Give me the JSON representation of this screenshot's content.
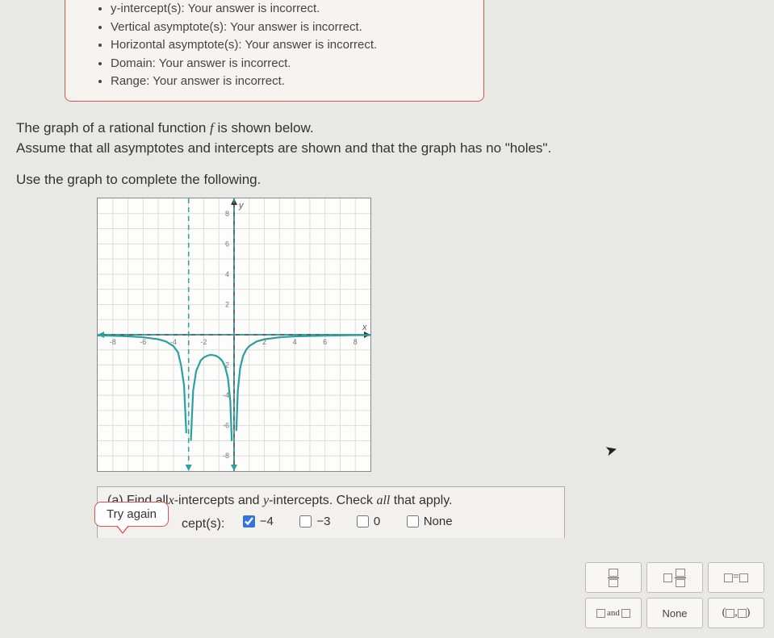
{
  "feedback": {
    "items": [
      {
        "label": "y-intercept(s):",
        "msg": "Your answer is incorrect."
      },
      {
        "label": "Vertical asymptote(s):",
        "msg": "Your answer is incorrect."
      },
      {
        "label": "Horizontal asymptote(s):",
        "msg": "Your answer is incorrect."
      },
      {
        "label": "Domain:",
        "msg": "Your answer is incorrect."
      },
      {
        "label": "Range:",
        "msg": "Your answer is incorrect."
      }
    ]
  },
  "problem": {
    "line1_pre": "The graph of a rational function ",
    "line1_f": "f",
    "line1_post": " is shown below.",
    "line2": "Assume that all asymptotes and intercepts are shown and that the graph has no \"holes\".",
    "instruction": "Use the graph to complete the following."
  },
  "chart_data": {
    "type": "line",
    "title": "",
    "xlabel": "x",
    "ylabel": "y",
    "xlim": [
      -9,
      9
    ],
    "ylim": [
      -9,
      9
    ],
    "x_ticks": [
      -8,
      -6,
      -4,
      -2,
      2,
      4,
      6,
      8
    ],
    "y_ticks": [
      -8,
      -6,
      -4,
      -2,
      2,
      4,
      6,
      8
    ],
    "vertical_asymptotes": [
      -3,
      0
    ],
    "horizontal_asymptotes": [
      0
    ],
    "series": [
      {
        "name": "left-branch",
        "x": [
          -9,
          -8,
          -7,
          -6,
          -5,
          -4.5,
          -4,
          -3.7,
          -3.5,
          -3.3,
          -3.15
        ],
        "y": [
          -0.05,
          -0.07,
          -0.1,
          -0.17,
          -0.3,
          -0.44,
          -0.75,
          -1.16,
          -2.0,
          -3.33,
          -6.5
        ]
      },
      {
        "name": "middle-branch",
        "x": [
          -2.85,
          -2.7,
          -2.5,
          -2.2,
          -2,
          -1.7,
          -1.5,
          -1.2,
          -1,
          -0.8,
          -0.6,
          -0.4,
          -0.25,
          -0.15
        ],
        "y": [
          -7.0,
          -3.7,
          -2.4,
          -1.7,
          -1.5,
          -1.36,
          -1.33,
          -1.39,
          -1.5,
          -1.7,
          -2.08,
          -2.88,
          -4.36,
          -7.02
        ]
      },
      {
        "name": "right-branch",
        "x": [
          0.15,
          0.25,
          0.4,
          0.6,
          0.8,
          1,
          1.5,
          2,
          3,
          4,
          6,
          8,
          9
        ],
        "y": [
          -6.35,
          -3.69,
          -2.21,
          -1.39,
          -0.99,
          -0.75,
          -0.44,
          -0.3,
          -0.17,
          -0.11,
          -0.06,
          -0.03,
          -0.03
        ]
      }
    ]
  },
  "part_a": {
    "label": "(a) Find all ",
    "mid1": "x",
    "mid2": "-intercepts and ",
    "mid3": "y",
    "mid4": "-intercepts. Check ",
    "mid5": "all",
    "mid6": " that apply.",
    "row_label": "cept(s):",
    "options": [
      {
        "label": "−4",
        "checked": true
      },
      {
        "label": "−3",
        "checked": false
      },
      {
        "label": "0",
        "checked": false
      },
      {
        "label": "None",
        "checked": false
      }
    ]
  },
  "try_again": "Try again",
  "toolbox": {
    "items": [
      "frac",
      "mixed",
      "eq",
      "and",
      "None",
      "interval"
    ]
  },
  "tool_labels": {
    "and": "and",
    "none": "None"
  }
}
